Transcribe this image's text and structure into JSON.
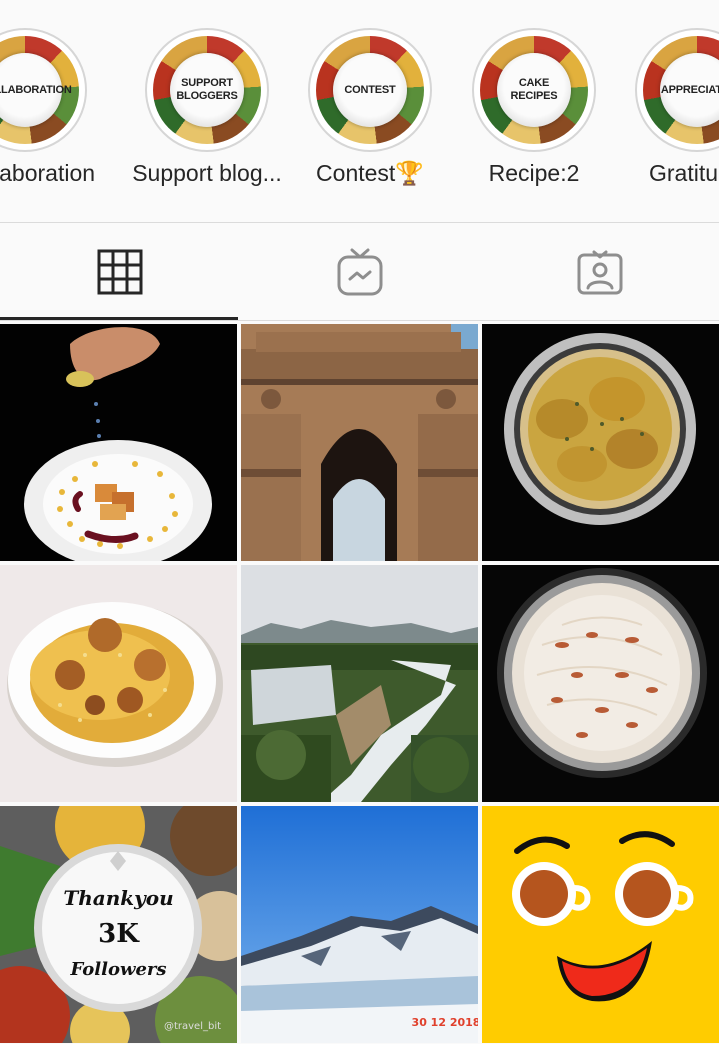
{
  "highlights": [
    {
      "label": "llaboration",
      "cover_text": "COLLABORATION"
    },
    {
      "label": "Support blog...",
      "cover_text": "SUPPORT\nBLOGGERS"
    },
    {
      "label": "Contest🏆",
      "cover_text": "CONTEST"
    },
    {
      "label": "Recipe:2",
      "cover_text": "CAKE\nRECIPES"
    },
    {
      "label": "Gratitu",
      "cover_text": "APPRECIATIO"
    }
  ],
  "tabs": [
    {
      "name": "grid",
      "icon": "grid-icon",
      "active": true
    },
    {
      "name": "igtv",
      "icon": "tv-icon",
      "active": false
    },
    {
      "name": "tagged",
      "icon": "tagged-person-icon",
      "active": false
    }
  ],
  "posts": {
    "thankyou_line1": "Thankyou",
    "thankyou_line2": "3K",
    "thankyou_line3": "Followers",
    "watermark": "@travel_bit",
    "date_stamp": "30 12 2018"
  },
  "colors": {
    "ring": "#d6d6d6",
    "text": "#262626",
    "active_tab": "#262626",
    "divider": "#dbdbdb",
    "emoji_yellow": "#ffcc00"
  }
}
